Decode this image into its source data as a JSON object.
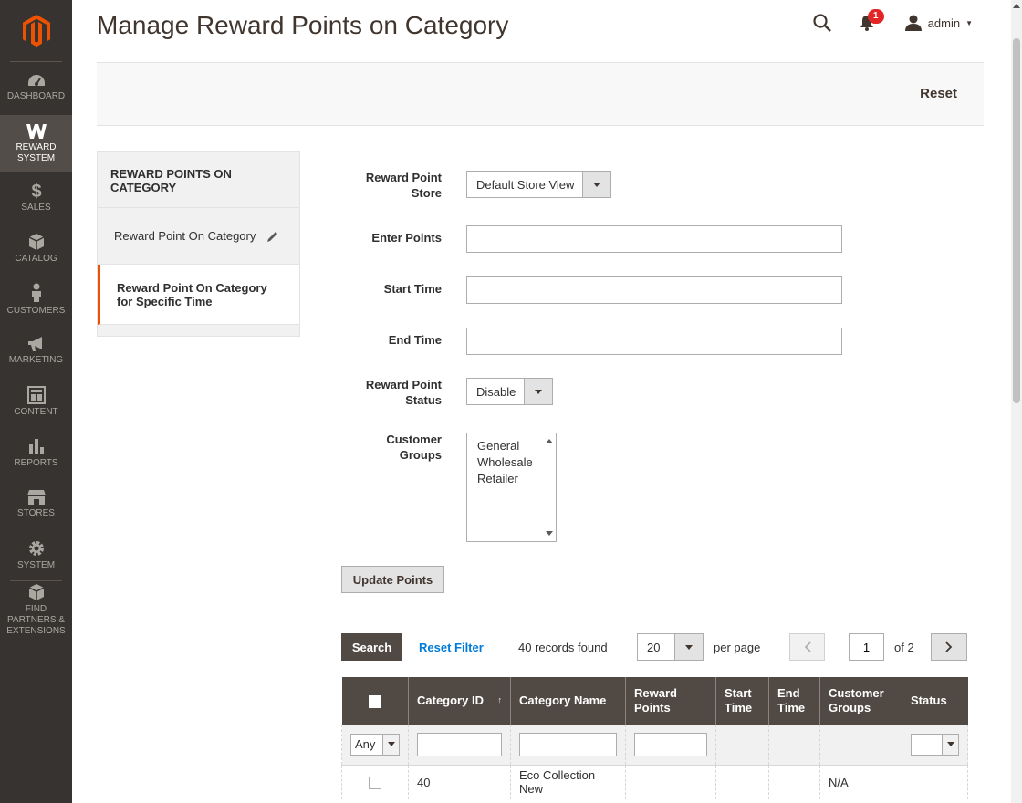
{
  "sidebar": {
    "items": [
      {
        "label": "Dashboard",
        "icon": "dashboard-icon"
      },
      {
        "label": "Reward System",
        "icon": "reward-system-icon"
      },
      {
        "label": "Sales",
        "icon": "dollar-icon"
      },
      {
        "label": "Catalog",
        "icon": "box-icon"
      },
      {
        "label": "Customers",
        "icon": "person-icon"
      },
      {
        "label": "Marketing",
        "icon": "megaphone-icon"
      },
      {
        "label": "Content",
        "icon": "layout-icon"
      },
      {
        "label": "Reports",
        "icon": "bar-chart-icon"
      },
      {
        "label": "Stores",
        "icon": "store-icon"
      },
      {
        "label": "System",
        "icon": "gear-icon"
      },
      {
        "label": "Find Partners & Extensions",
        "icon": "extensions-icon"
      }
    ]
  },
  "header": {
    "title": "Manage Reward Points on Category",
    "notification_count": "1",
    "user": "admin"
  },
  "actions": {
    "reset_label": "Reset"
  },
  "tabs": {
    "title": "REWARD POINTS ON CATEGORY",
    "items": [
      {
        "label": "Reward Point On Category"
      },
      {
        "label": "Reward Point On Category for Specific Time"
      }
    ]
  },
  "form": {
    "store_label": "Reward Point Store",
    "store_value": "Default Store View",
    "points_label": "Enter Points",
    "start_label": "Start Time",
    "end_label": "End Time",
    "status_label": "Reward Point Status",
    "status_value": "Disable",
    "groups_label": "Customer Groups",
    "groups_options": [
      "General",
      "Wholesale",
      "Retailer"
    ],
    "update_label": "Update Points"
  },
  "grid": {
    "search_label": "Search",
    "reset_filter_label": "Reset Filter",
    "records": "40 records found",
    "per_page_value": "20",
    "per_page_label": "per page",
    "page": "1",
    "page_of": "of 2",
    "columns": [
      "Category ID",
      "Category Name",
      "Reward Points",
      "Start Time",
      "End Time",
      "Customer Groups",
      "Status"
    ],
    "filter_any": "Any",
    "rows": [
      {
        "id": "40",
        "name": "Eco Collection New",
        "points": "",
        "start": "",
        "end": "",
        "groups": "N/A",
        "status": ""
      }
    ]
  },
  "colors": {
    "sidebar_bg": "#373330",
    "accent": "#eb5202",
    "grid_header": "#514943",
    "link": "#007bdb"
  }
}
